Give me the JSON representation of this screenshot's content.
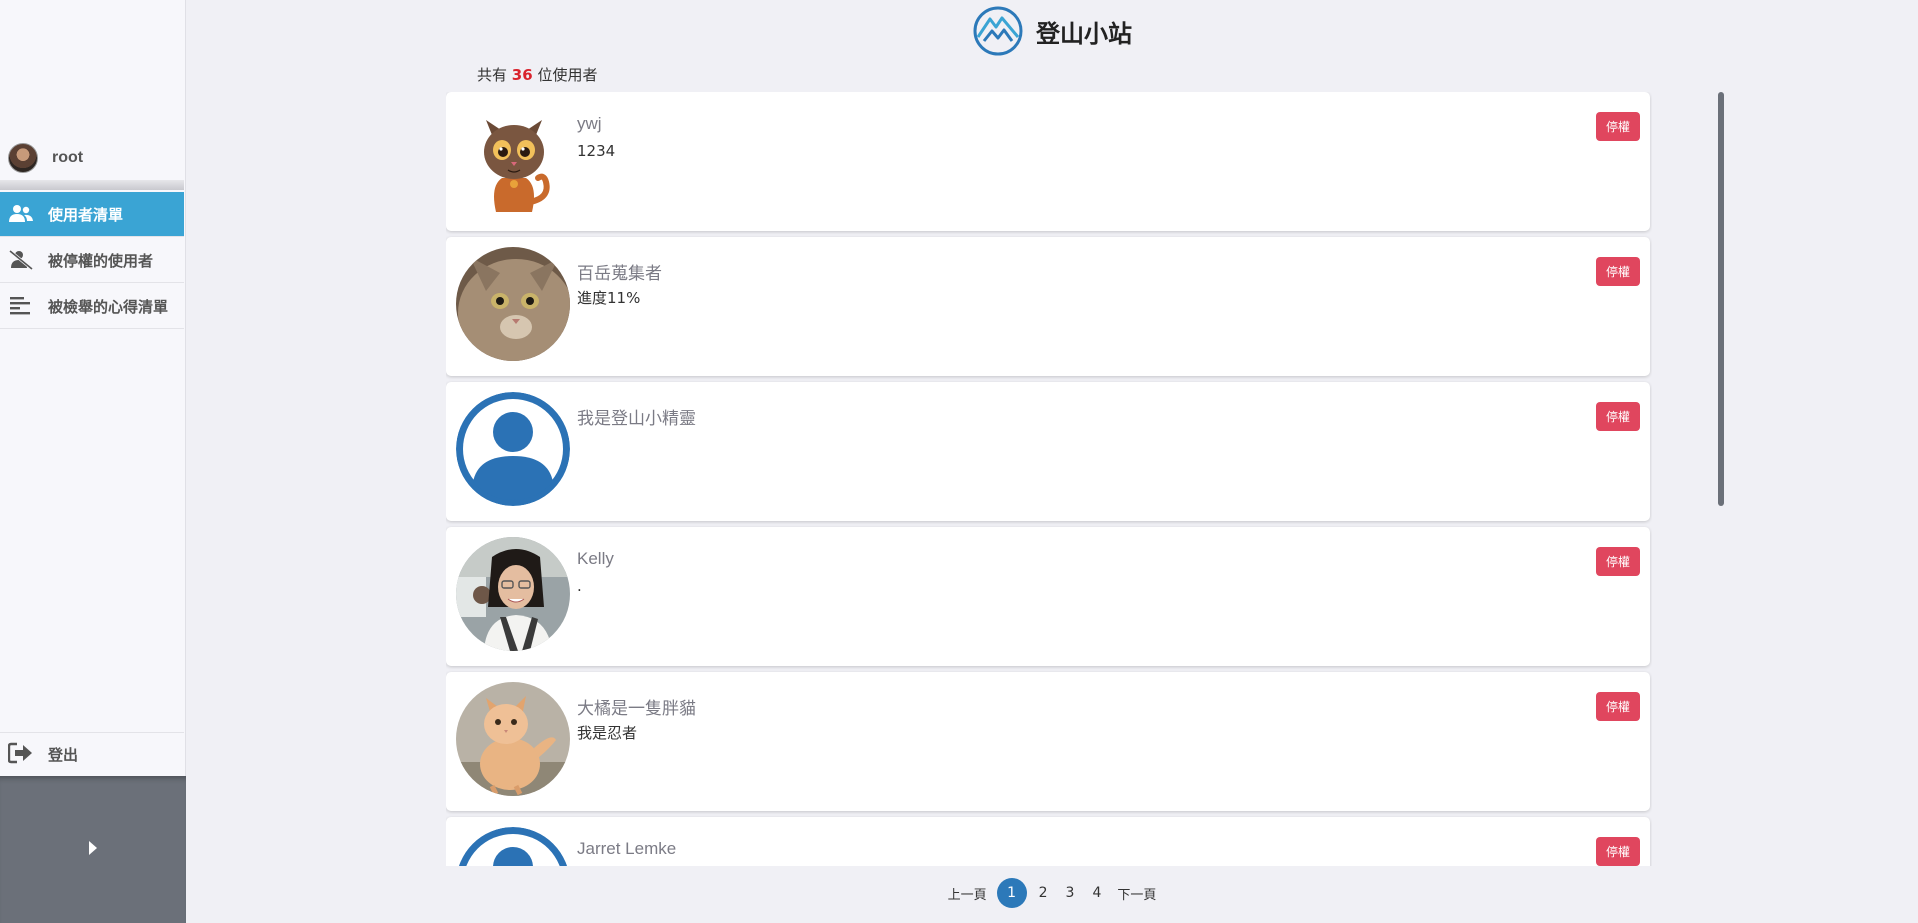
{
  "header": {
    "site_title": "登山小站"
  },
  "user_count": {
    "prefix": "共有",
    "number": "36",
    "suffix": "位使用者"
  },
  "sidebar": {
    "profile_name": "root",
    "items": [
      {
        "label": "使用者清單",
        "icon": "users-icon",
        "active": true
      },
      {
        "label": "被停權的使用者",
        "icon": "user-slash-icon",
        "active": false
      },
      {
        "label": "被檢舉的心得清單",
        "icon": "align-left-icon",
        "active": false
      }
    ],
    "logout_label": "登出",
    "collapse_icon": "caret-right-icon"
  },
  "users": [
    {
      "name": "ywj",
      "bio": "1234",
      "avatar": "cartoon-cat-avatar",
      "action": "停權"
    },
    {
      "name": "百岳蒐集者",
      "bio": "進度11%",
      "avatar": "cat-photo-avatar",
      "action": "停權"
    },
    {
      "name": "我是登山小精靈",
      "bio": "",
      "avatar": "default-user-avatar",
      "action": "停權"
    },
    {
      "name": "Kelly",
      "bio": ".",
      "avatar": "person-photo-avatar",
      "action": "停權"
    },
    {
      "name": "大橘是一隻胖貓",
      "bio": "我是忍者",
      "avatar": "orange-cat-photo-avatar",
      "action": "停權"
    },
    {
      "name": "Jarret Lemke",
      "bio": "",
      "avatar": "default-user-avatar",
      "action": "停權"
    }
  ],
  "pagination": {
    "prev_label": "上一頁",
    "pages": [
      "1",
      "2",
      "3",
      "4"
    ],
    "current": "1",
    "next_label": "下一頁"
  },
  "colors": {
    "active_nav": "#3aa4d4",
    "ban_button": "#e0465e",
    "count_highlight": "#d9232d",
    "current_page": "#2c79b9",
    "default_avatar": "#2b72b5"
  }
}
